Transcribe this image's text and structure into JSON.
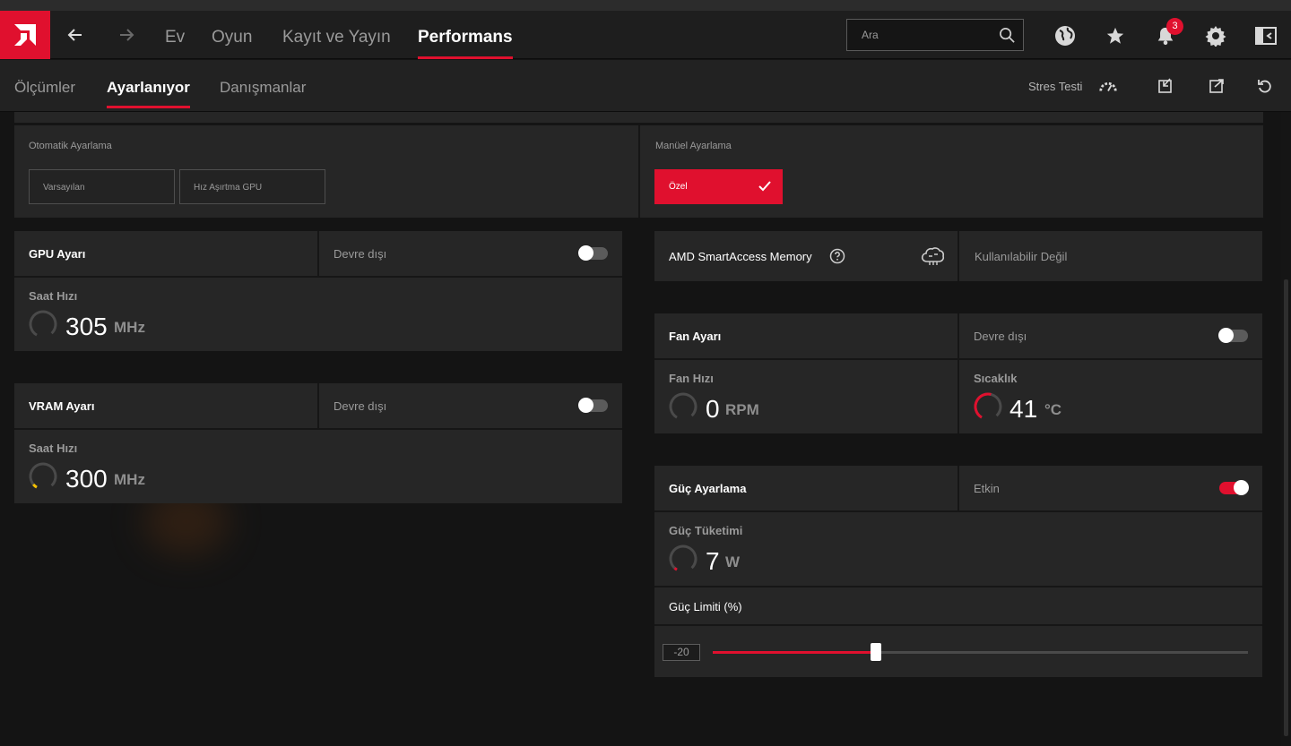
{
  "topbar": {
    "logo_icon": "amd-logo-icon",
    "back_icon": "arrow-left-icon",
    "forward_icon": "arrow-right-icon",
    "tabs": [
      {
        "label": "Ev",
        "active": false
      },
      {
        "label": "Oyun",
        "active": false
      },
      {
        "label": "Kayıt ve Yayın",
        "active": false
      },
      {
        "label": "Performans",
        "active": true
      }
    ],
    "search_placeholder": "Ara",
    "notification_count": "3",
    "icons": [
      "globe-icon",
      "star-icon",
      "bell-icon",
      "gear-icon",
      "sidebar-toggle-icon"
    ]
  },
  "subbar": {
    "tabs": [
      {
        "label": "Ölçümler",
        "active": false
      },
      {
        "label": "Ayarlanıyor",
        "active": true
      },
      {
        "label": "Danışmanlar",
        "active": false
      }
    ],
    "stress_test_label": "Stres Testi",
    "icons": [
      "stress-gauge-icon",
      "import-icon",
      "export-icon",
      "reset-icon"
    ]
  },
  "tuning": {
    "auto_label": "Otomatik Ayarlama",
    "auto_options": [
      "Varsayılan",
      "Hız Aşırtma GPU"
    ],
    "manual_label": "Manüel Ayarlama",
    "manual_option": "Özel"
  },
  "gpu": {
    "title": "GPU Ayarı",
    "state": "Devre dışı",
    "enabled": false,
    "metric_label": "Saat Hızı",
    "value": "305",
    "unit": "MHz"
  },
  "vram": {
    "title": "VRAM Ayarı",
    "state": "Devre dışı",
    "enabled": false,
    "metric_label": "Saat Hızı",
    "value": "300",
    "unit": "MHz"
  },
  "sam": {
    "title": "AMD SmartAccess Memory",
    "status": "Kullanılabilir Değil"
  },
  "fan": {
    "title": "Fan Ayarı",
    "state": "Devre dışı",
    "enabled": false,
    "speed_label": "Fan Hızı",
    "speed_value": "0",
    "speed_unit": "RPM",
    "temp_label": "Sıcaklık",
    "temp_value": "41",
    "temp_unit": "°C"
  },
  "power": {
    "title": "Güç Ayarlama",
    "state": "Etkin",
    "enabled": true,
    "consumption_label": "Güç Tüketimi",
    "consumption_value": "7",
    "consumption_unit": "W",
    "limit_label": "Güç Limiti (%)",
    "limit_value": "-20",
    "limit_min": -50,
    "limit_max": 50,
    "limit_slider_fraction": 0.305
  },
  "colors": {
    "accent": "#e0102e",
    "background": "#141414",
    "panel": "#262626"
  }
}
